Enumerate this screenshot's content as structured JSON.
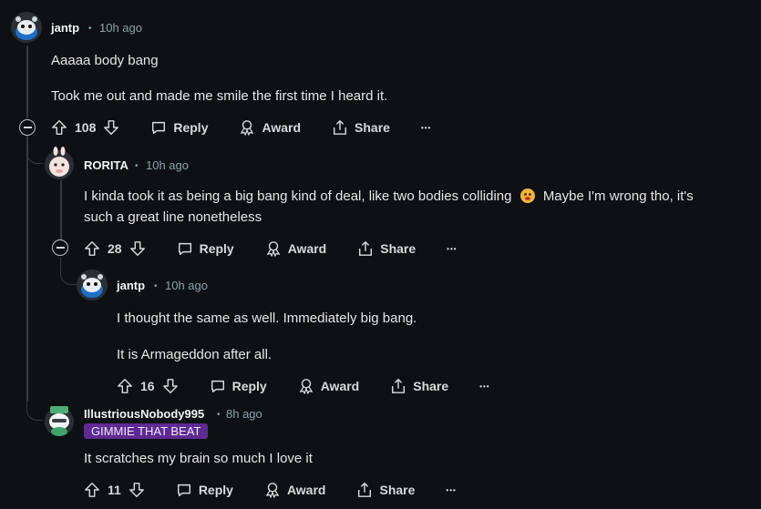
{
  "comments": [
    {
      "username": "jantp",
      "time": "10h ago",
      "body": [
        "Aaaaa body bang",
        "Took me out and made me smile the first time I heard it."
      ],
      "votes": "108"
    },
    {
      "username": "RORITA",
      "time": "10h ago",
      "body_line1_pre": "I kinda took it as being a big bang kind of deal, like two bodies colliding",
      "body_line1_post": "Maybe I'm wrong tho, it's",
      "body_line2": "such a great line nonetheless",
      "votes": "28"
    },
    {
      "username": "jantp",
      "time": "10h ago",
      "body": [
        "I thought the same as well. Immediately big bang.",
        "It is Armageddon after all."
      ],
      "votes": "16"
    },
    {
      "username": "IllustriousNobody995",
      "time": "8h ago",
      "flair": "GIMMIE THAT BEAT",
      "body": [
        "It scratches my brain so much I love it"
      ],
      "votes": "11"
    }
  ],
  "actions": {
    "reply": "Reply",
    "award": "Award",
    "share": "Share",
    "more": "•••"
  },
  "separator": "•",
  "colors": {
    "background": "#0e1113",
    "flair": "#5f2a93",
    "meta": "#8ba2ad"
  }
}
